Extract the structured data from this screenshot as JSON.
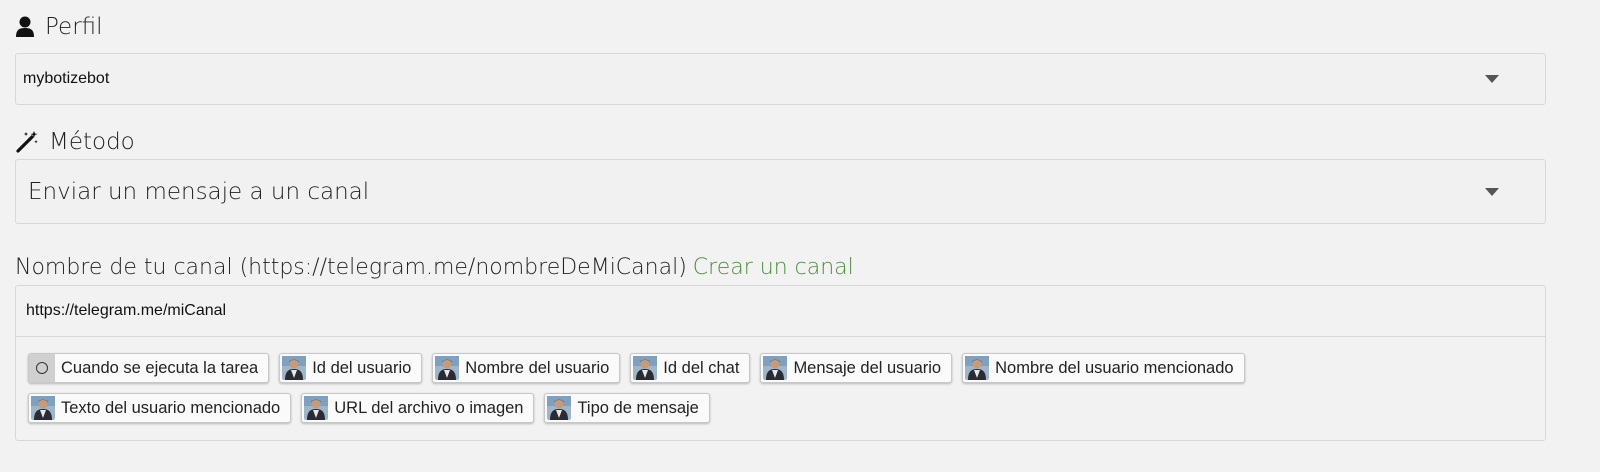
{
  "perfil": {
    "label": "Perfil",
    "icon": "user-icon",
    "selected": "mybotizebot"
  },
  "metodo": {
    "label": "Método",
    "icon": "magic-wand-icon",
    "selected": "Enviar un mensaje a un canal"
  },
  "canal": {
    "label": "Nombre de tu canal (https://telegram.me/nombreDeMiCanal)",
    "link": "Crear un canal",
    "link_color": "#4e8c3c",
    "value": "https://telegram.me/miCanal"
  },
  "tags": [
    {
      "label": "Cuando se ejecuta la tarea",
      "icon": "circle-icon"
    },
    {
      "label": "Id del usuario",
      "icon": "avatar-icon"
    },
    {
      "label": "Nombre del usuario",
      "icon": "avatar-icon"
    },
    {
      "label": "Id del chat",
      "icon": "avatar-icon"
    },
    {
      "label": "Mensaje del usuario",
      "icon": "avatar-icon"
    },
    {
      "label": "Nombre del usuario mencionado",
      "icon": "avatar-icon"
    },
    {
      "label": "Texto del usuario mencionado",
      "icon": "avatar-icon"
    },
    {
      "label": "URL del archivo o imagen",
      "icon": "avatar-icon"
    },
    {
      "label": "Tipo de mensaje",
      "icon": "avatar-icon"
    }
  ]
}
